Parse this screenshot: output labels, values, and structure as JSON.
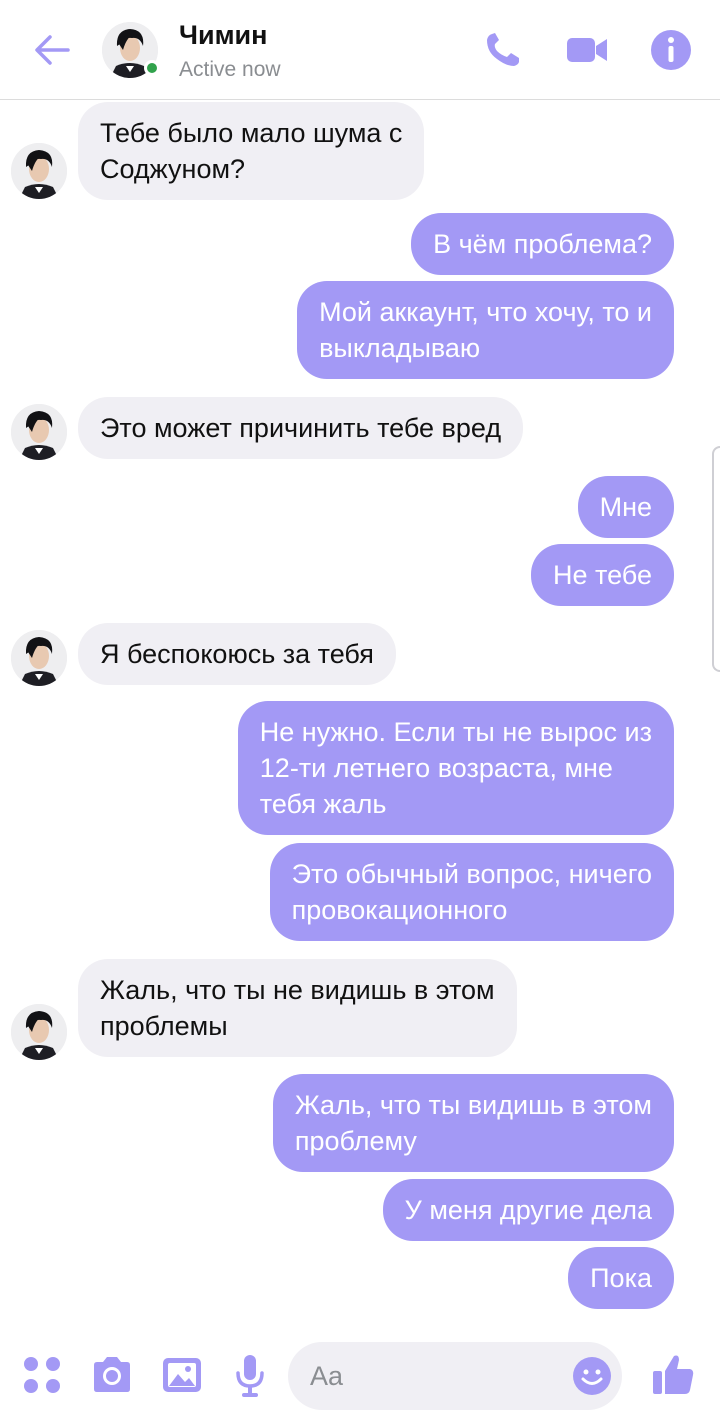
{
  "colors": {
    "accent": "#a399f5",
    "received_bubble": "#f0eff4",
    "presence": "#31a24c",
    "status_text": "#8a8d91"
  },
  "header": {
    "contact_name": "Чимин",
    "status": "Active now",
    "icons": [
      "back-arrow-icon",
      "phone-icon",
      "video-camera-icon",
      "info-icon"
    ]
  },
  "messages": [
    {
      "from": "contact",
      "lines": [
        "Тебе было мало шума с",
        "Соджуном?"
      ]
    },
    {
      "from": "me",
      "lines": [
        "В чём проблема?"
      ]
    },
    {
      "from": "me",
      "lines": [
        "Мой аккаунт, что хочу, то и",
        "выкладываю"
      ]
    },
    {
      "from": "contact",
      "lines": [
        "Это может причинить тебе вред"
      ]
    },
    {
      "from": "me",
      "lines": [
        "Мне"
      ]
    },
    {
      "from": "me",
      "lines": [
        "Не тебе"
      ]
    },
    {
      "from": "contact",
      "lines": [
        "Я беспокоюсь за тебя"
      ]
    },
    {
      "from": "me",
      "lines": [
        "Не нужно. Если ты не вырос из",
        "12-ти летнего возраста, мне",
        "тебя жаль"
      ]
    },
    {
      "from": "me",
      "lines": [
        "Это обычный вопрос, ничего",
        "провокационного"
      ]
    },
    {
      "from": "contact",
      "lines": [
        "Жаль, что ты не видишь в этом",
        "проблемы"
      ]
    },
    {
      "from": "me",
      "lines": [
        "Жаль, что ты видишь в этом",
        "проблему"
      ]
    },
    {
      "from": "me",
      "lines": [
        "У меня другие дела"
      ]
    },
    {
      "from": "me",
      "lines": [
        "Пока"
      ]
    }
  ],
  "composer": {
    "placeholder": "Aa",
    "icons": [
      "more-dots-icon",
      "camera-icon",
      "image-icon",
      "microphone-icon",
      "emoji-icon",
      "thumbs-up-icon"
    ]
  }
}
